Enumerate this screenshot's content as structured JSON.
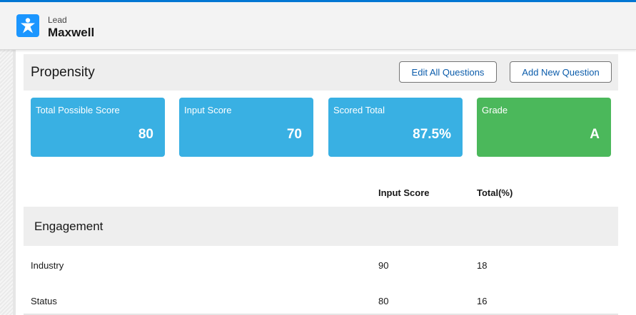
{
  "header": {
    "object_type": "Lead",
    "record_name": "Maxwell",
    "icon": "lead-person-icon",
    "icon_color": "#1b96ff"
  },
  "propensity": {
    "title": "Propensity",
    "edit_button": "Edit All Questions",
    "add_button": "Add New Question"
  },
  "tiles": [
    {
      "label": "Total Possible Score",
      "value": "80",
      "color": "#39b0e3"
    },
    {
      "label": "Input Score",
      "value": "70",
      "color": "#39b0e3"
    },
    {
      "label": "Scored Total",
      "value": "87.5%",
      "color": "#39b0e3"
    },
    {
      "label": "Grade",
      "value": "A",
      "color": "#4bb85b"
    }
  ],
  "table": {
    "columns": {
      "input_score": "Input Score",
      "total": "Total(%)"
    },
    "section": "Engagement",
    "rows": [
      {
        "name": "Industry",
        "input_score": "90",
        "total": "18"
      },
      {
        "name": "Status",
        "input_score": "80",
        "total": "16"
      }
    ]
  }
}
